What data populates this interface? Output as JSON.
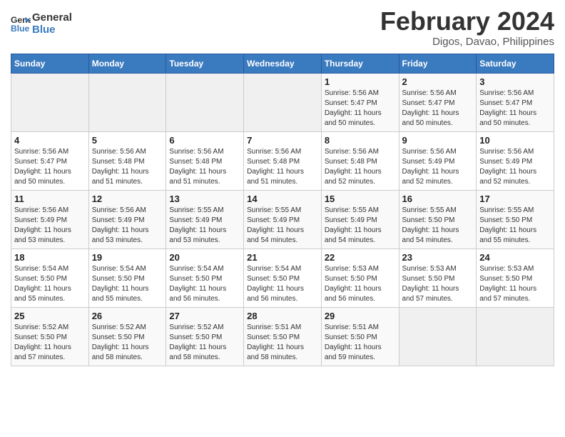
{
  "logo": {
    "line1": "General",
    "line2": "Blue"
  },
  "title": "February 2024",
  "subtitle": "Digos, Davao, Philippines",
  "headers": [
    "Sunday",
    "Monday",
    "Tuesday",
    "Wednesday",
    "Thursday",
    "Friday",
    "Saturday"
  ],
  "weeks": [
    [
      {
        "day": "",
        "info": ""
      },
      {
        "day": "",
        "info": ""
      },
      {
        "day": "",
        "info": ""
      },
      {
        "day": "",
        "info": ""
      },
      {
        "day": "1",
        "info": "Sunrise: 5:56 AM\nSunset: 5:47 PM\nDaylight: 11 hours\nand 50 minutes."
      },
      {
        "day": "2",
        "info": "Sunrise: 5:56 AM\nSunset: 5:47 PM\nDaylight: 11 hours\nand 50 minutes."
      },
      {
        "day": "3",
        "info": "Sunrise: 5:56 AM\nSunset: 5:47 PM\nDaylight: 11 hours\nand 50 minutes."
      }
    ],
    [
      {
        "day": "4",
        "info": "Sunrise: 5:56 AM\nSunset: 5:47 PM\nDaylight: 11 hours\nand 50 minutes."
      },
      {
        "day": "5",
        "info": "Sunrise: 5:56 AM\nSunset: 5:48 PM\nDaylight: 11 hours\nand 51 minutes."
      },
      {
        "day": "6",
        "info": "Sunrise: 5:56 AM\nSunset: 5:48 PM\nDaylight: 11 hours\nand 51 minutes."
      },
      {
        "day": "7",
        "info": "Sunrise: 5:56 AM\nSunset: 5:48 PM\nDaylight: 11 hours\nand 51 minutes."
      },
      {
        "day": "8",
        "info": "Sunrise: 5:56 AM\nSunset: 5:48 PM\nDaylight: 11 hours\nand 52 minutes."
      },
      {
        "day": "9",
        "info": "Sunrise: 5:56 AM\nSunset: 5:49 PM\nDaylight: 11 hours\nand 52 minutes."
      },
      {
        "day": "10",
        "info": "Sunrise: 5:56 AM\nSunset: 5:49 PM\nDaylight: 11 hours\nand 52 minutes."
      }
    ],
    [
      {
        "day": "11",
        "info": "Sunrise: 5:56 AM\nSunset: 5:49 PM\nDaylight: 11 hours\nand 53 minutes."
      },
      {
        "day": "12",
        "info": "Sunrise: 5:56 AM\nSunset: 5:49 PM\nDaylight: 11 hours\nand 53 minutes."
      },
      {
        "day": "13",
        "info": "Sunrise: 5:55 AM\nSunset: 5:49 PM\nDaylight: 11 hours\nand 53 minutes."
      },
      {
        "day": "14",
        "info": "Sunrise: 5:55 AM\nSunset: 5:49 PM\nDaylight: 11 hours\nand 54 minutes."
      },
      {
        "day": "15",
        "info": "Sunrise: 5:55 AM\nSunset: 5:49 PM\nDaylight: 11 hours\nand 54 minutes."
      },
      {
        "day": "16",
        "info": "Sunrise: 5:55 AM\nSunset: 5:50 PM\nDaylight: 11 hours\nand 54 minutes."
      },
      {
        "day": "17",
        "info": "Sunrise: 5:55 AM\nSunset: 5:50 PM\nDaylight: 11 hours\nand 55 minutes."
      }
    ],
    [
      {
        "day": "18",
        "info": "Sunrise: 5:54 AM\nSunset: 5:50 PM\nDaylight: 11 hours\nand 55 minutes."
      },
      {
        "day": "19",
        "info": "Sunrise: 5:54 AM\nSunset: 5:50 PM\nDaylight: 11 hours\nand 55 minutes."
      },
      {
        "day": "20",
        "info": "Sunrise: 5:54 AM\nSunset: 5:50 PM\nDaylight: 11 hours\nand 56 minutes."
      },
      {
        "day": "21",
        "info": "Sunrise: 5:54 AM\nSunset: 5:50 PM\nDaylight: 11 hours\nand 56 minutes."
      },
      {
        "day": "22",
        "info": "Sunrise: 5:53 AM\nSunset: 5:50 PM\nDaylight: 11 hours\nand 56 minutes."
      },
      {
        "day": "23",
        "info": "Sunrise: 5:53 AM\nSunset: 5:50 PM\nDaylight: 11 hours\nand 57 minutes."
      },
      {
        "day": "24",
        "info": "Sunrise: 5:53 AM\nSunset: 5:50 PM\nDaylight: 11 hours\nand 57 minutes."
      }
    ],
    [
      {
        "day": "25",
        "info": "Sunrise: 5:52 AM\nSunset: 5:50 PM\nDaylight: 11 hours\nand 57 minutes."
      },
      {
        "day": "26",
        "info": "Sunrise: 5:52 AM\nSunset: 5:50 PM\nDaylight: 11 hours\nand 58 minutes."
      },
      {
        "day": "27",
        "info": "Sunrise: 5:52 AM\nSunset: 5:50 PM\nDaylight: 11 hours\nand 58 minutes."
      },
      {
        "day": "28",
        "info": "Sunrise: 5:51 AM\nSunset: 5:50 PM\nDaylight: 11 hours\nand 58 minutes."
      },
      {
        "day": "29",
        "info": "Sunrise: 5:51 AM\nSunset: 5:50 PM\nDaylight: 11 hours\nand 59 minutes."
      },
      {
        "day": "",
        "info": ""
      },
      {
        "day": "",
        "info": ""
      }
    ]
  ]
}
